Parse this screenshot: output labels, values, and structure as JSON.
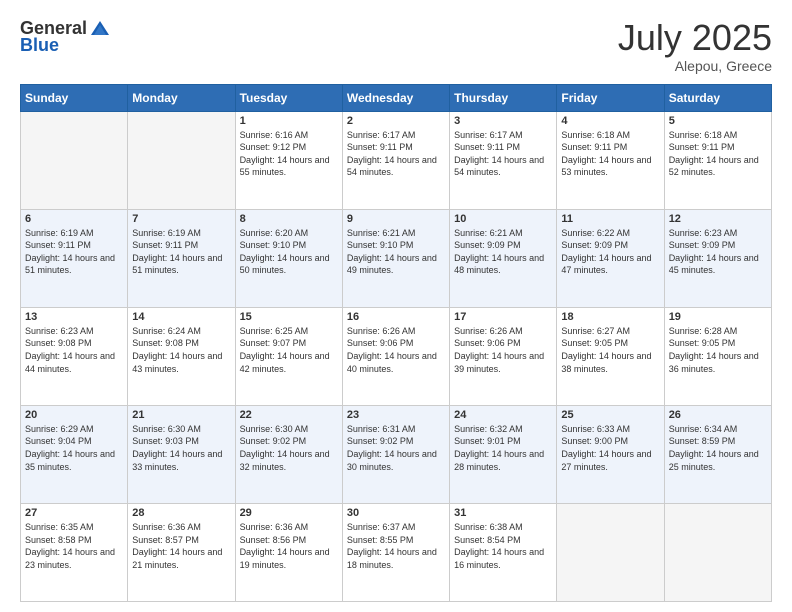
{
  "header": {
    "logo_general": "General",
    "logo_blue": "Blue",
    "month_year": "July 2025",
    "location": "Alepou, Greece"
  },
  "days_of_week": [
    "Sunday",
    "Monday",
    "Tuesday",
    "Wednesday",
    "Thursday",
    "Friday",
    "Saturday"
  ],
  "weeks": [
    [
      {
        "day": "",
        "empty": true
      },
      {
        "day": "",
        "empty": true
      },
      {
        "day": "1",
        "sunrise": "Sunrise: 6:16 AM",
        "sunset": "Sunset: 9:12 PM",
        "daylight": "Daylight: 14 hours and 55 minutes."
      },
      {
        "day": "2",
        "sunrise": "Sunrise: 6:17 AM",
        "sunset": "Sunset: 9:11 PM",
        "daylight": "Daylight: 14 hours and 54 minutes."
      },
      {
        "day": "3",
        "sunrise": "Sunrise: 6:17 AM",
        "sunset": "Sunset: 9:11 PM",
        "daylight": "Daylight: 14 hours and 54 minutes."
      },
      {
        "day": "4",
        "sunrise": "Sunrise: 6:18 AM",
        "sunset": "Sunset: 9:11 PM",
        "daylight": "Daylight: 14 hours and 53 minutes."
      },
      {
        "day": "5",
        "sunrise": "Sunrise: 6:18 AM",
        "sunset": "Sunset: 9:11 PM",
        "daylight": "Daylight: 14 hours and 52 minutes."
      }
    ],
    [
      {
        "day": "6",
        "sunrise": "Sunrise: 6:19 AM",
        "sunset": "Sunset: 9:11 PM",
        "daylight": "Daylight: 14 hours and 51 minutes."
      },
      {
        "day": "7",
        "sunrise": "Sunrise: 6:19 AM",
        "sunset": "Sunset: 9:11 PM",
        "daylight": "Daylight: 14 hours and 51 minutes."
      },
      {
        "day": "8",
        "sunrise": "Sunrise: 6:20 AM",
        "sunset": "Sunset: 9:10 PM",
        "daylight": "Daylight: 14 hours and 50 minutes."
      },
      {
        "day": "9",
        "sunrise": "Sunrise: 6:21 AM",
        "sunset": "Sunset: 9:10 PM",
        "daylight": "Daylight: 14 hours and 49 minutes."
      },
      {
        "day": "10",
        "sunrise": "Sunrise: 6:21 AM",
        "sunset": "Sunset: 9:09 PM",
        "daylight": "Daylight: 14 hours and 48 minutes."
      },
      {
        "day": "11",
        "sunrise": "Sunrise: 6:22 AM",
        "sunset": "Sunset: 9:09 PM",
        "daylight": "Daylight: 14 hours and 47 minutes."
      },
      {
        "day": "12",
        "sunrise": "Sunrise: 6:23 AM",
        "sunset": "Sunset: 9:09 PM",
        "daylight": "Daylight: 14 hours and 45 minutes."
      }
    ],
    [
      {
        "day": "13",
        "sunrise": "Sunrise: 6:23 AM",
        "sunset": "Sunset: 9:08 PM",
        "daylight": "Daylight: 14 hours and 44 minutes."
      },
      {
        "day": "14",
        "sunrise": "Sunrise: 6:24 AM",
        "sunset": "Sunset: 9:08 PM",
        "daylight": "Daylight: 14 hours and 43 minutes."
      },
      {
        "day": "15",
        "sunrise": "Sunrise: 6:25 AM",
        "sunset": "Sunset: 9:07 PM",
        "daylight": "Daylight: 14 hours and 42 minutes."
      },
      {
        "day": "16",
        "sunrise": "Sunrise: 6:26 AM",
        "sunset": "Sunset: 9:06 PM",
        "daylight": "Daylight: 14 hours and 40 minutes."
      },
      {
        "day": "17",
        "sunrise": "Sunrise: 6:26 AM",
        "sunset": "Sunset: 9:06 PM",
        "daylight": "Daylight: 14 hours and 39 minutes."
      },
      {
        "day": "18",
        "sunrise": "Sunrise: 6:27 AM",
        "sunset": "Sunset: 9:05 PM",
        "daylight": "Daylight: 14 hours and 38 minutes."
      },
      {
        "day": "19",
        "sunrise": "Sunrise: 6:28 AM",
        "sunset": "Sunset: 9:05 PM",
        "daylight": "Daylight: 14 hours and 36 minutes."
      }
    ],
    [
      {
        "day": "20",
        "sunrise": "Sunrise: 6:29 AM",
        "sunset": "Sunset: 9:04 PM",
        "daylight": "Daylight: 14 hours and 35 minutes."
      },
      {
        "day": "21",
        "sunrise": "Sunrise: 6:30 AM",
        "sunset": "Sunset: 9:03 PM",
        "daylight": "Daylight: 14 hours and 33 minutes."
      },
      {
        "day": "22",
        "sunrise": "Sunrise: 6:30 AM",
        "sunset": "Sunset: 9:02 PM",
        "daylight": "Daylight: 14 hours and 32 minutes."
      },
      {
        "day": "23",
        "sunrise": "Sunrise: 6:31 AM",
        "sunset": "Sunset: 9:02 PM",
        "daylight": "Daylight: 14 hours and 30 minutes."
      },
      {
        "day": "24",
        "sunrise": "Sunrise: 6:32 AM",
        "sunset": "Sunset: 9:01 PM",
        "daylight": "Daylight: 14 hours and 28 minutes."
      },
      {
        "day": "25",
        "sunrise": "Sunrise: 6:33 AM",
        "sunset": "Sunset: 9:00 PM",
        "daylight": "Daylight: 14 hours and 27 minutes."
      },
      {
        "day": "26",
        "sunrise": "Sunrise: 6:34 AM",
        "sunset": "Sunset: 8:59 PM",
        "daylight": "Daylight: 14 hours and 25 minutes."
      }
    ],
    [
      {
        "day": "27",
        "sunrise": "Sunrise: 6:35 AM",
        "sunset": "Sunset: 8:58 PM",
        "daylight": "Daylight: 14 hours and 23 minutes."
      },
      {
        "day": "28",
        "sunrise": "Sunrise: 6:36 AM",
        "sunset": "Sunset: 8:57 PM",
        "daylight": "Daylight: 14 hours and 21 minutes."
      },
      {
        "day": "29",
        "sunrise": "Sunrise: 6:36 AM",
        "sunset": "Sunset: 8:56 PM",
        "daylight": "Daylight: 14 hours and 19 minutes."
      },
      {
        "day": "30",
        "sunrise": "Sunrise: 6:37 AM",
        "sunset": "Sunset: 8:55 PM",
        "daylight": "Daylight: 14 hours and 18 minutes."
      },
      {
        "day": "31",
        "sunrise": "Sunrise: 6:38 AM",
        "sunset": "Sunset: 8:54 PM",
        "daylight": "Daylight: 14 hours and 16 minutes."
      },
      {
        "day": "",
        "empty": true
      },
      {
        "day": "",
        "empty": true
      }
    ]
  ]
}
